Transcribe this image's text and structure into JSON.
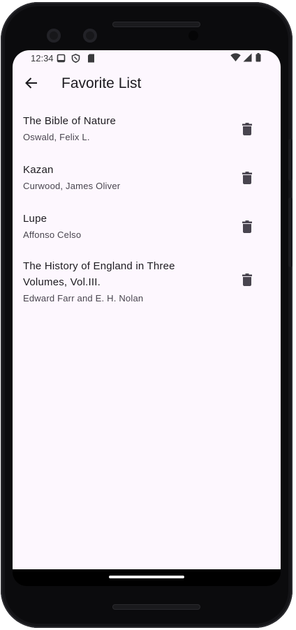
{
  "status_bar": {
    "time": "12:34",
    "icons": [
      "sim-icon",
      "shield-icon",
      "sd-card-icon",
      "wifi-icon",
      "signal-icon",
      "battery-icon"
    ]
  },
  "app_bar": {
    "title": "Favorite List",
    "back_icon": "arrow-back-icon"
  },
  "favorites": [
    {
      "title": "The Bible of Nature",
      "author": "Oswald, Felix L."
    },
    {
      "title": "Kazan",
      "author": "Curwood, James Oliver"
    },
    {
      "title": "Lupe",
      "author": "Affonso Celso"
    },
    {
      "title": "The History of England in Three Volumes, Vol.III.",
      "author": "Edward Farr and E. H. Nolan"
    }
  ],
  "item_action_icon": "delete-icon",
  "colors": {
    "background": "#fdf7fe",
    "text_primary": "#1d1b20",
    "text_secondary": "#49454f",
    "icon": "#49454f"
  }
}
